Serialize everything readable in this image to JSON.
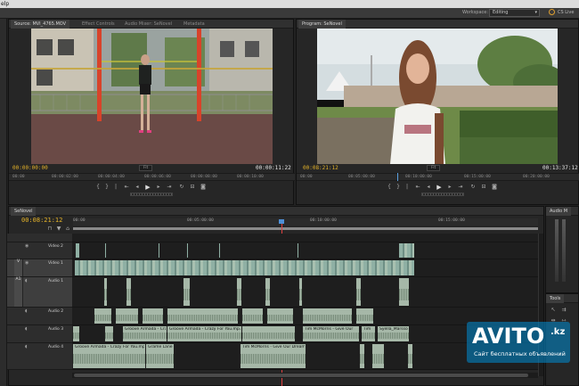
{
  "menu": {
    "help": "elp"
  },
  "workspace": {
    "label": "Workspace:",
    "value": "Editing",
    "cs_label": "CS Live"
  },
  "source": {
    "tabs": [
      "Source: MVI_4765.MOV",
      "Effect Controls",
      "Audio Mixer: SeNovel",
      "Metadata"
    ],
    "timecode_left": "00:00:00:00",
    "zoom": "Fit",
    "timecode_right": "00:00:11:22",
    "ruler": [
      "00:00",
      "00:00:02:00",
      "00:00:04:00",
      "00:00:06:00",
      "00:00:08:00",
      "00:00:10:00"
    ]
  },
  "program": {
    "tabs": [
      "Program: SeNovel"
    ],
    "timecode_left": "00:08:21:12",
    "zoom": "Fit",
    "timecode_right": "00:13:37:12",
    "ruler": [
      "00:00",
      "00:05:00:00",
      "00:10:00:00",
      "00:15:00:00",
      "00:20:00:00"
    ]
  },
  "timeline": {
    "tab": "SeNovel",
    "timecode": "00:08:21:12",
    "ruler": [
      "00:00",
      "00:05:00:00",
      "00:10:00:00",
      "00:15:00:00"
    ],
    "tracks": [
      {
        "id": "v2",
        "name": "Video 2",
        "target": ""
      },
      {
        "id": "v1",
        "name": "Video 1",
        "target": "V"
      },
      {
        "id": "a1",
        "name": "Audio 1",
        "target": "A1"
      },
      {
        "id": "a2",
        "name": "Audio 2",
        "target": ""
      },
      {
        "id": "a3",
        "name": "Audio 3",
        "target": ""
      },
      {
        "id": "a4",
        "name": "Audio 4",
        "target": ""
      }
    ],
    "clip_labels": {
      "a3_1": "Groove Armada - Crazy For You.mp3",
      "a3_2": "Groove Armada - Crazy For You.mp3",
      "a3_3": "Tim McMorris - Give Our",
      "a3_4": "Tim",
      "a3_5": "Syella_Marsson",
      "a4_1": "Groove Armada - Crazy For You.mp3",
      "a4_2": "Grame Lane",
      "a4_3": "Tim McMorris - Give Our Dreams"
    }
  },
  "audio_meters": {
    "tab": "Audio M"
  },
  "tools": {
    "tab": "Tools"
  },
  "watermark": {
    "brand": "AVITO",
    "tld": ".kz",
    "tagline": "Сайт бесплатных объявлений"
  },
  "colors": {
    "accent_timecode": "#e6b429",
    "playhead": "#e04040",
    "watermark": "#008cd2"
  }
}
